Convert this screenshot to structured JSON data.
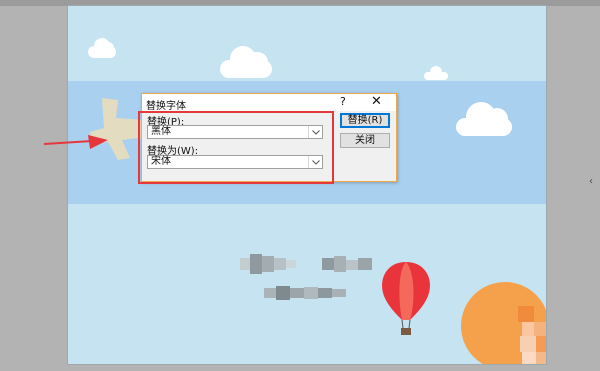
{
  "dialog": {
    "title": "替换字体",
    "help_label": "?",
    "close_label": "✕",
    "replace_label": "替换(P):",
    "replace_value": "黑体",
    "with_label": "替换为(W):",
    "with_value": "宋体",
    "replace_button": "替换(R)",
    "close_button": "关闭"
  },
  "icons": {
    "dropdown": "chevron-down-icon",
    "annotation_arrow": "red-arrow-icon",
    "side_arrow": "chevron-left-icon"
  },
  "colors": {
    "highlight": "#e5373c",
    "slide_background": "#c5e3f1",
    "band": "#a9d0ee",
    "dialog_border": "#f0a84c",
    "default_button_border": "#0078d7"
  },
  "right_edge_glyph": "‹"
}
